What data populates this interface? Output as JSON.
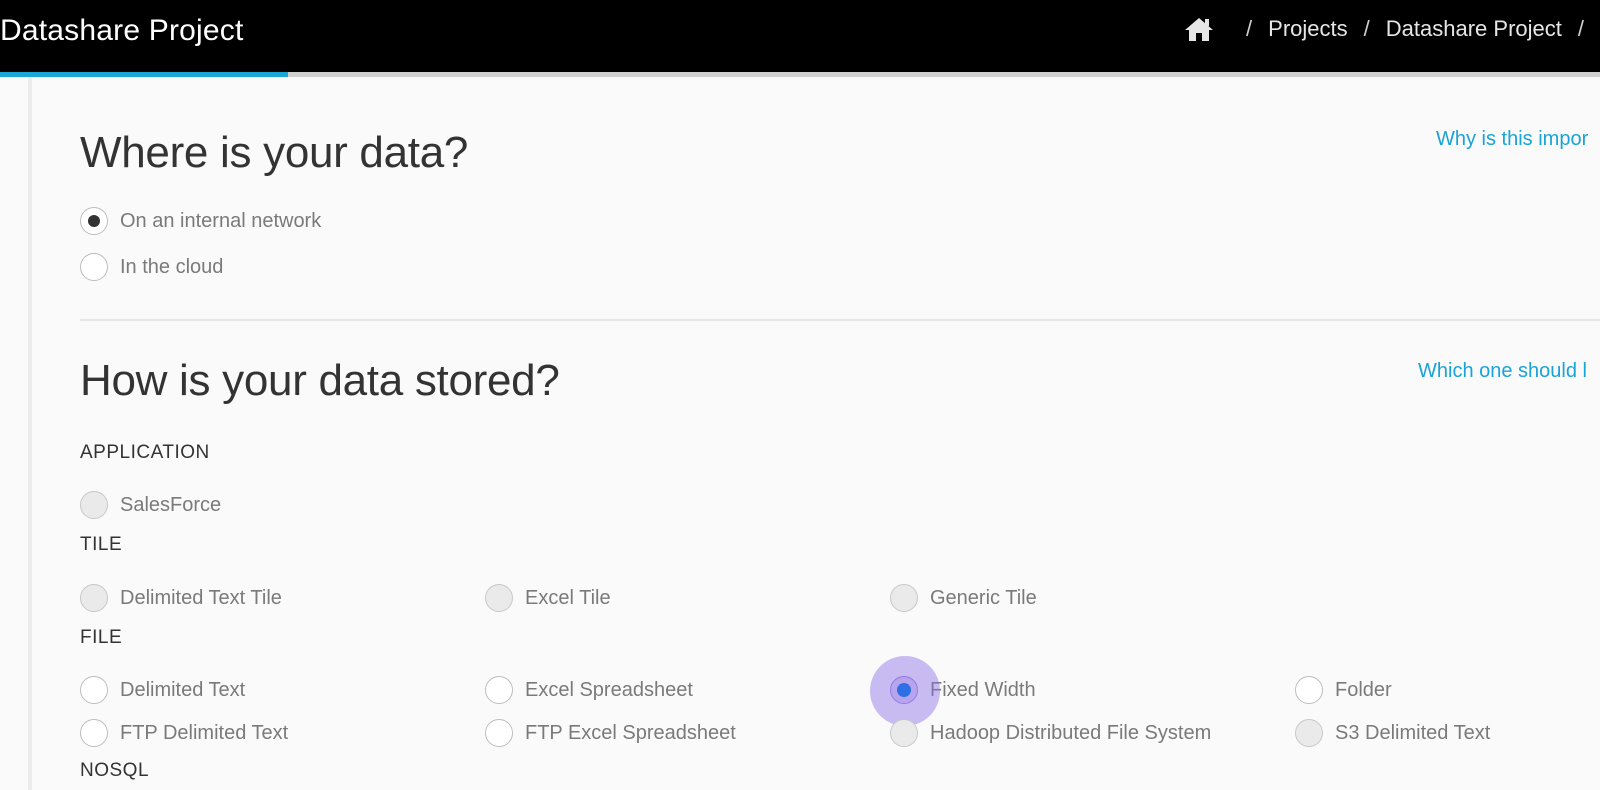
{
  "header": {
    "title": "Datashare Project",
    "breadcrumb": [
      "Projects",
      "Datashare Project"
    ],
    "separator": "/",
    "home_icon": "home-icon",
    "background": "#000000",
    "progress_percent": 18,
    "progress_color": "#1ca6d8"
  },
  "location_section": {
    "title": "Where is your data?",
    "help_link": "Why is this impor",
    "options": [
      {
        "label": "On an internal network",
        "selected": true
      },
      {
        "label": "In the cloud",
        "selected": false
      }
    ]
  },
  "storage_section": {
    "title": "How is your data stored?",
    "help_link": "Which one should l",
    "categories": [
      {
        "name": "APPLICATION",
        "options": [
          "SalesForce"
        ]
      },
      {
        "name": "TILE",
        "options": [
          "Delimited Text Tile",
          "Excel Tile",
          "Generic Tile"
        ]
      },
      {
        "name": "FILE",
        "options": [
          "Delimited Text",
          "Excel Spreadsheet",
          "Fixed Width",
          "Folder",
          "FTP Delimited Text",
          "FTP Excel Spreadsheet",
          "Hadoop Distributed File System",
          "S3 Delimited Text"
        ]
      },
      {
        "name": "NOSQL",
        "options": []
      }
    ],
    "selected_option": "Fixed Width",
    "accent_color": "#2f6fe6"
  }
}
